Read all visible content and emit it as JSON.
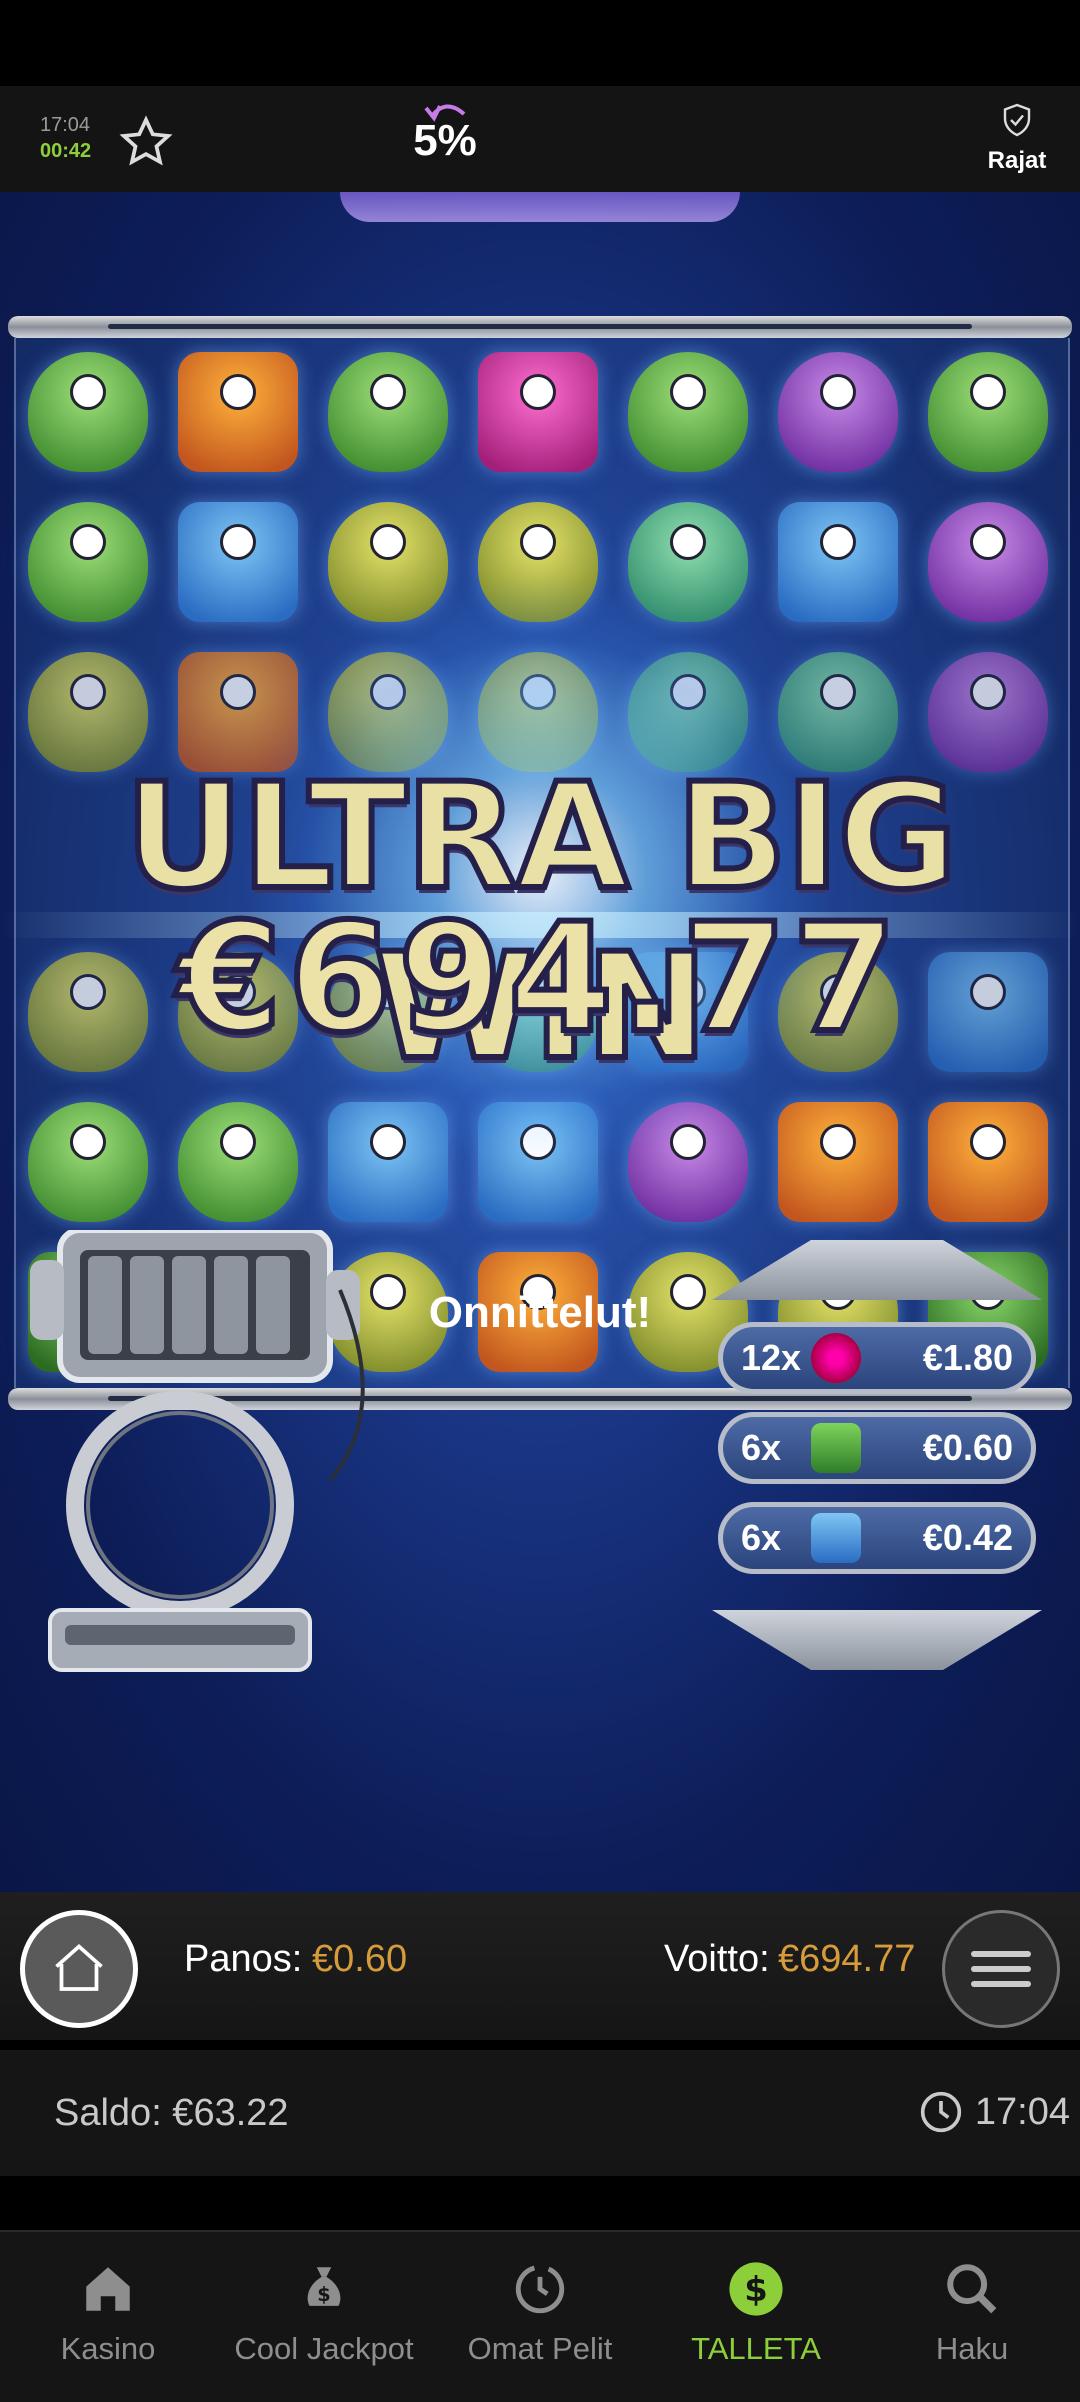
{
  "status": {
    "time": "17:04",
    "session_timer": "00:42"
  },
  "header": {
    "rtp_percent": "5%",
    "limits_label": "Rajat"
  },
  "game": {
    "win_title": "ULTRA BIG WIN",
    "win_amount": "€694.77",
    "congrats": "Onnittelut!",
    "paytable": [
      {
        "multiplier": "12x",
        "icon": "pink-monster-icon",
        "amount": "€1.80"
      },
      {
        "multiplier": "6x",
        "icon": "green-monster-icon",
        "amount": "€0.60"
      },
      {
        "multiplier": "6x",
        "icon": "blue-monster-icon",
        "amount": "€0.42"
      }
    ]
  },
  "betbar": {
    "bet_label": "Panos:",
    "bet_value": "€0.60",
    "win_label": "Voitto:",
    "win_value": "€694.77"
  },
  "balance": {
    "text": "Saldo: €63.22",
    "clock": "17:04"
  },
  "nav": [
    {
      "label": "Kasino",
      "icon": "home-icon"
    },
    {
      "label": "Cool Jackpot",
      "icon": "money-bag-icon"
    },
    {
      "label": "Omat Pelit",
      "icon": "history-icon"
    },
    {
      "label": "TALLETA",
      "icon": "dollar-icon"
    },
    {
      "label": "Haku",
      "icon": "search-icon"
    }
  ],
  "colors": {
    "accent": "#8ccf3a",
    "bet": "#d69b3a",
    "win_text": "#e9e0a6"
  }
}
